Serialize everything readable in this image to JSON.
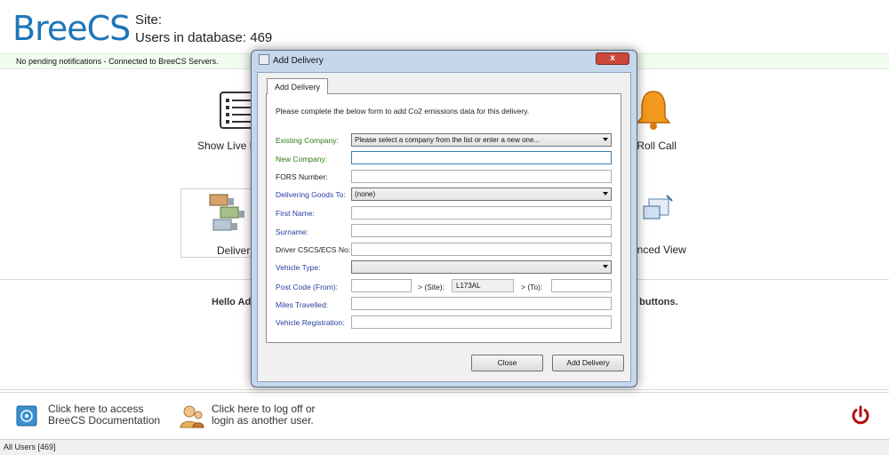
{
  "header": {
    "logo": "BreeCS",
    "site_label": "Site:",
    "users_label": "Users in database: 469"
  },
  "notification": "No pending notifications - Connected to BreeCS Servers.",
  "tiles": {
    "live": "Show Live E",
    "rollcall": "e Roll Call",
    "deliveries": "Deliverie",
    "advanced": "anced View"
  },
  "hello": {
    "left": "Hello Adm",
    "right": "e buttons."
  },
  "bottom": {
    "docs_line1": "Click here to access",
    "docs_line2": "BreeCS Documentation",
    "logoff_line1": "Click here to log off or",
    "logoff_line2": "login as another user."
  },
  "status": "All Users [469]",
  "dialog": {
    "title": "Add Delivery",
    "close_glyph": "x",
    "tab": "Add Delivery",
    "intro": "Please complete the below form to add Co2 emissions data for this delivery.",
    "labels": {
      "existing_company": "Existing Company:",
      "new_company": "New Company:",
      "fors": "FORS Number:",
      "delivering_to": "Delivering Goods To:",
      "first_name": "First Name:",
      "surname": "Surname:",
      "driver_cscs": "Driver CSCS/ECS No:",
      "vehicle_type": "Vehicle Type:",
      "postcode_from": "Post Code (From):",
      "site": "> (Site):",
      "to": "> (To):",
      "miles": "Miles Travelled:",
      "vehicle_reg": "Vehicle Registration:"
    },
    "values": {
      "existing_company": "Please select a company from the list or enter a new one...",
      "delivering_to": "(none)",
      "site_postcode": "L173AL"
    },
    "buttons": {
      "close": "Close",
      "add": "Add Delivery"
    }
  },
  "colors": {
    "brand": "#1f76b8",
    "green_label": "#2c7a18",
    "blue_label": "#2a3e9e",
    "power": "#b01010"
  }
}
